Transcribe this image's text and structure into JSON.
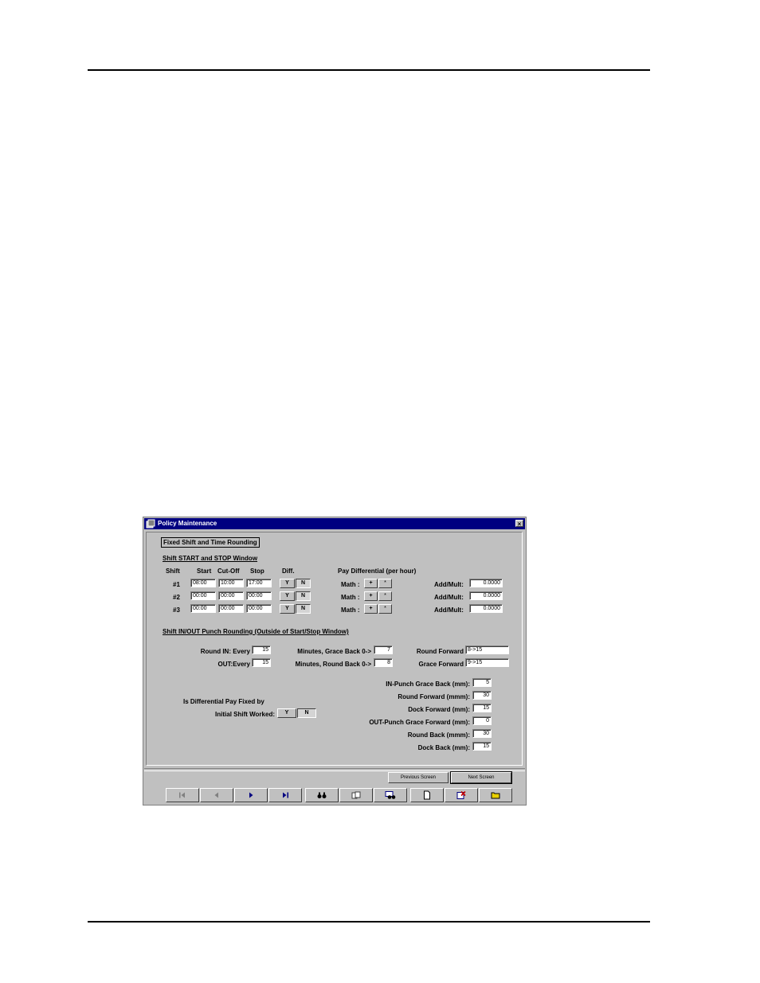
{
  "window": {
    "title": "Policy Maintenance",
    "close_label": "×"
  },
  "tab": {
    "label": "Fixed Shift and Time Rounding"
  },
  "shift_window": {
    "heading": "Shift START and STOP Window",
    "headers": {
      "shift": "Shift",
      "start": "Start",
      "cutoff": "Cut-Off",
      "stop": "Stop",
      "diff": "Diff."
    },
    "pay_diff_heading": "Pay Differential (per hour)",
    "math_label": "Math :",
    "addmult_label": "Add/Mult:",
    "y_label": "Y",
    "n_label": "N",
    "plus_label": "+",
    "times_label": "*",
    "rows": [
      {
        "shift": "#1",
        "start": "08:00",
        "cutoff": "10:00",
        "stop": "17:00",
        "addmult": "0.0000"
      },
      {
        "shift": "#2",
        "start": "00:00",
        "cutoff": "00:00",
        "stop": "00:00",
        "addmult": "0.0000"
      },
      {
        "shift": "#3",
        "start": "00:00",
        "cutoff": "00:00",
        "stop": "00:00",
        "addmult": "0.0000"
      }
    ]
  },
  "punch_rounding": {
    "heading": "Shift IN/OUT Punch Rounding (Outside of Start/Stop Window)",
    "round_in_label": "Round IN: Every",
    "round_in_value": "15",
    "out_label": "OUT:Every",
    "out_value": "15",
    "grace_back_label": "Minutes, Grace Back 0->",
    "grace_back_value": "7",
    "round_back_label": "Minutes, Round Back 0->",
    "round_back_value": "8",
    "round_forward_label": "Round Forward",
    "round_forward_value": "8->15",
    "grace_forward_label": "Grace Forward",
    "grace_forward_value": "9->15"
  },
  "differential": {
    "line1": "Is Differential Pay Fixed by",
    "line2": "Initial Shift Worked:",
    "y_label": "Y",
    "n_label": "N"
  },
  "punch_settings": [
    {
      "label": "IN-Punch Grace Back (mm):",
      "value": "5"
    },
    {
      "label": "Round Forward (mmm):",
      "value": "30"
    },
    {
      "label": "Dock Forward (mm):",
      "value": "15"
    },
    {
      "label": "OUT-Punch Grace Forward (mm):",
      "value": "0"
    },
    {
      "label": "Round Back (mmm):",
      "value": "30"
    },
    {
      "label": "Dock Back (mm):",
      "value": "15"
    }
  ],
  "buttons": {
    "previous": "Previous Screen",
    "next": "Next Screen"
  },
  "navbar_icons": [
    "first-record-icon",
    "previous-record-icon",
    "next-record-icon",
    "last-record-icon",
    "find-icon",
    "copy-icon",
    "search-records-icon",
    "new-record-icon",
    "delete-record-icon",
    "open-folder-icon"
  ]
}
